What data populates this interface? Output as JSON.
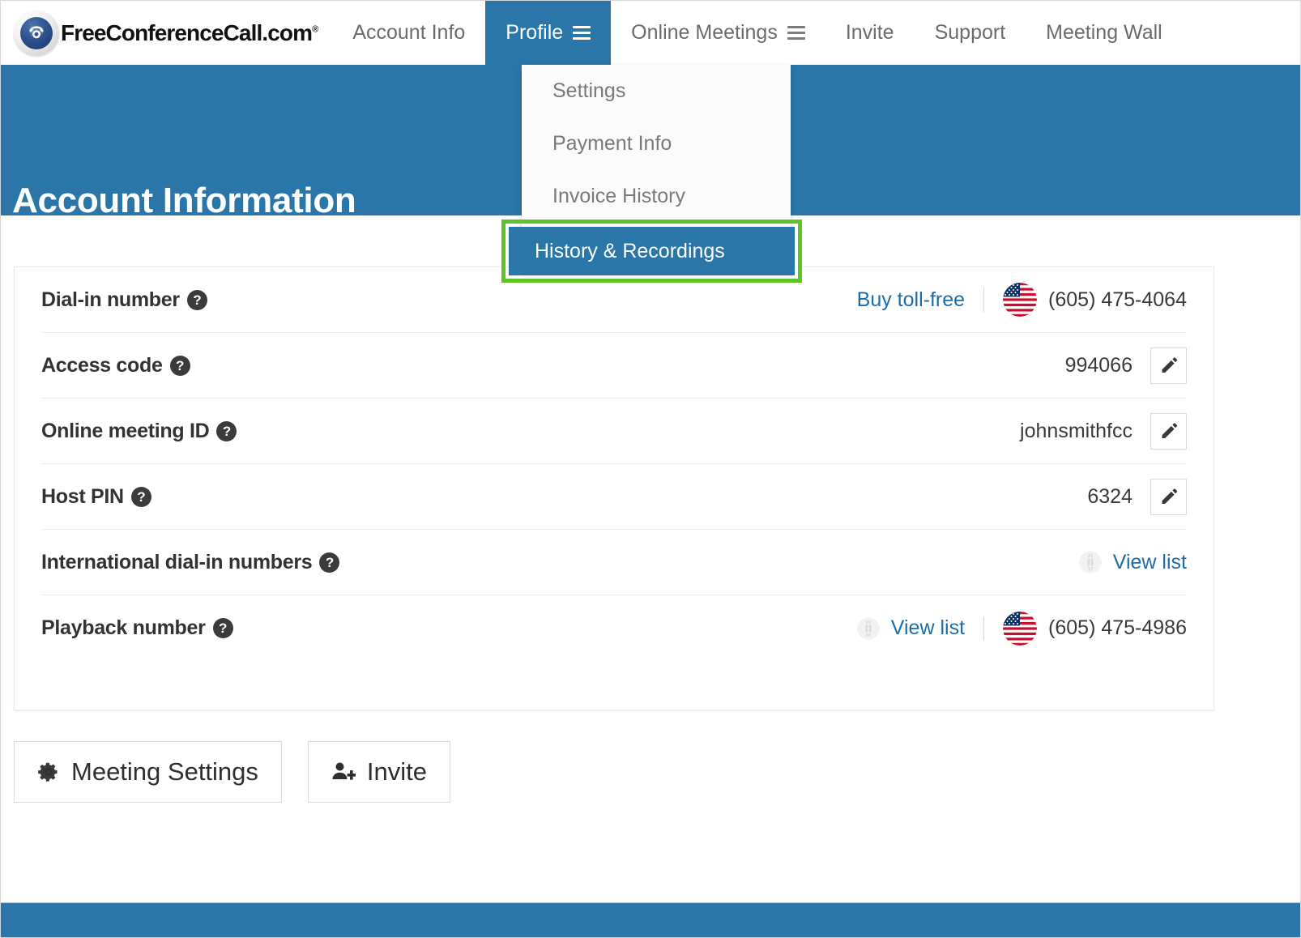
{
  "brand": {
    "name": "FreeConferenceCall.com",
    "trademark": "®",
    "logo_icon": "telephone-icon"
  },
  "nav": {
    "items": [
      {
        "label": "Account Info",
        "active": false,
        "has_menu": false
      },
      {
        "label": "Profile",
        "active": true,
        "has_menu": true
      },
      {
        "label": "Online Meetings",
        "active": false,
        "has_menu": true
      },
      {
        "label": "Invite",
        "active": false,
        "has_menu": false
      },
      {
        "label": "Support",
        "active": false,
        "has_menu": false
      },
      {
        "label": "Meeting Wall",
        "active": false,
        "has_menu": false
      }
    ]
  },
  "dropdown": {
    "items": [
      {
        "label": "Settings",
        "selected": false
      },
      {
        "label": "Payment Info",
        "selected": false
      },
      {
        "label": "Invoice History",
        "selected": false
      }
    ],
    "selected_item": {
      "label": "History & Recordings",
      "selected": true
    },
    "highlight_color": "#5ec42a"
  },
  "header": {
    "title": "Account Information",
    "background_color": "#2a76a8"
  },
  "account": {
    "rows": [
      {
        "label": "Dial-in number",
        "help_icon": "question-mark-icon",
        "link": "Buy toll-free",
        "has_divider": true,
        "flag": "us-flag-icon",
        "value": "(605) 475-4064",
        "has_edit": false,
        "globe_link": null
      },
      {
        "label": "Access code",
        "help_icon": "question-mark-icon",
        "link": null,
        "has_divider": false,
        "flag": null,
        "value": "994066",
        "has_edit": true,
        "globe_link": null
      },
      {
        "label": "Online meeting ID",
        "help_icon": "question-mark-icon",
        "link": null,
        "has_divider": false,
        "flag": null,
        "value": "johnsmithfcc",
        "has_edit": true,
        "globe_link": null
      },
      {
        "label": "Host PIN",
        "help_icon": "question-mark-icon",
        "link": null,
        "has_divider": false,
        "flag": null,
        "value": "6324",
        "has_edit": true,
        "globe_link": null
      },
      {
        "label": "International dial-in numbers",
        "help_icon": "question-mark-icon",
        "link": null,
        "has_divider": false,
        "flag": null,
        "value": null,
        "has_edit": false,
        "globe_link": "View list"
      },
      {
        "label": "Playback number",
        "help_icon": "question-mark-icon",
        "link": null,
        "has_divider": true,
        "flag": "us-flag-icon",
        "value": "(605) 475-4986",
        "has_edit": false,
        "globe_link": "View list"
      }
    ]
  },
  "actions": {
    "meeting_settings": {
      "label": "Meeting Settings",
      "icon": "gear-icon"
    },
    "invite": {
      "label": "Invite",
      "icon": "add-user-icon"
    }
  },
  "colors": {
    "primary_blue": "#2a76a8",
    "link_blue": "#1b6ca8",
    "highlight_green": "#5ec42a"
  }
}
